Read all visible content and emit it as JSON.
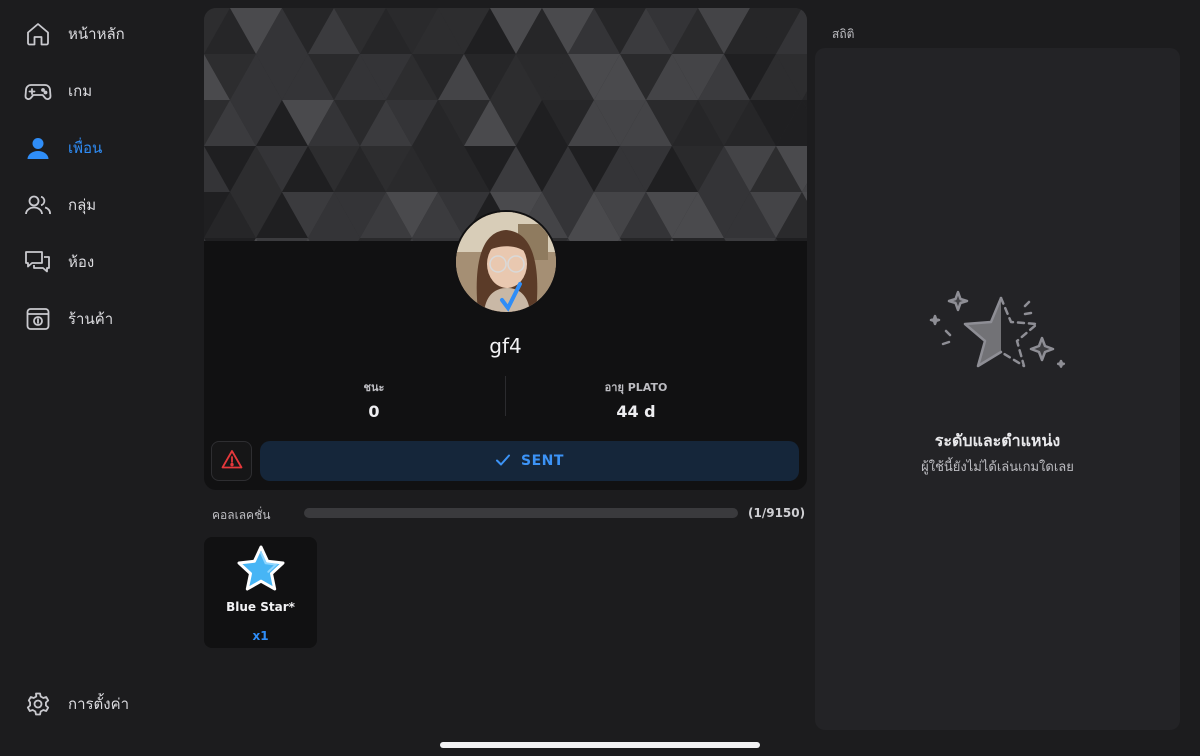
{
  "sidebar": {
    "items": [
      {
        "label": "หน้าหลัก",
        "icon": "home-icon",
        "active": false
      },
      {
        "label": "เกม",
        "icon": "gamepad-icon",
        "active": false
      },
      {
        "label": "เพื่อน",
        "icon": "person-icon",
        "active": true
      },
      {
        "label": "กลุ่ม",
        "icon": "group-icon",
        "active": false
      },
      {
        "label": "ห้อง",
        "icon": "chat-icon",
        "active": false
      },
      {
        "label": "ร้านค้า",
        "icon": "shop-icon",
        "active": false
      }
    ],
    "settings": {
      "label": "การตั้งค่า",
      "icon": "gear-icon"
    }
  },
  "profile": {
    "username": "gf4",
    "stats": [
      {
        "label": "ชนะ",
        "value": "0"
      },
      {
        "label": "อายุ PLATO",
        "value": "44 d"
      }
    ],
    "sent_label": "SENT"
  },
  "collection": {
    "label": "คอลเลคชั่น",
    "count": "(1/9150)",
    "progress": 0.0001,
    "items": [
      {
        "name": "Blue Star*",
        "quantity": "x1",
        "icon": "blue-star-icon"
      }
    ]
  },
  "stats": {
    "title": "สถิติ",
    "heading": "ระดับและตำแหน่ง",
    "subtext": "ผู้ใช้นี้ยังไม่ได้เล่นเกมใดเลย"
  },
  "colors": {
    "background": "#1c1c1e",
    "accent": "#2f8df7",
    "card": "#111112",
    "panel": "#232326",
    "warning": "#e5383b"
  }
}
